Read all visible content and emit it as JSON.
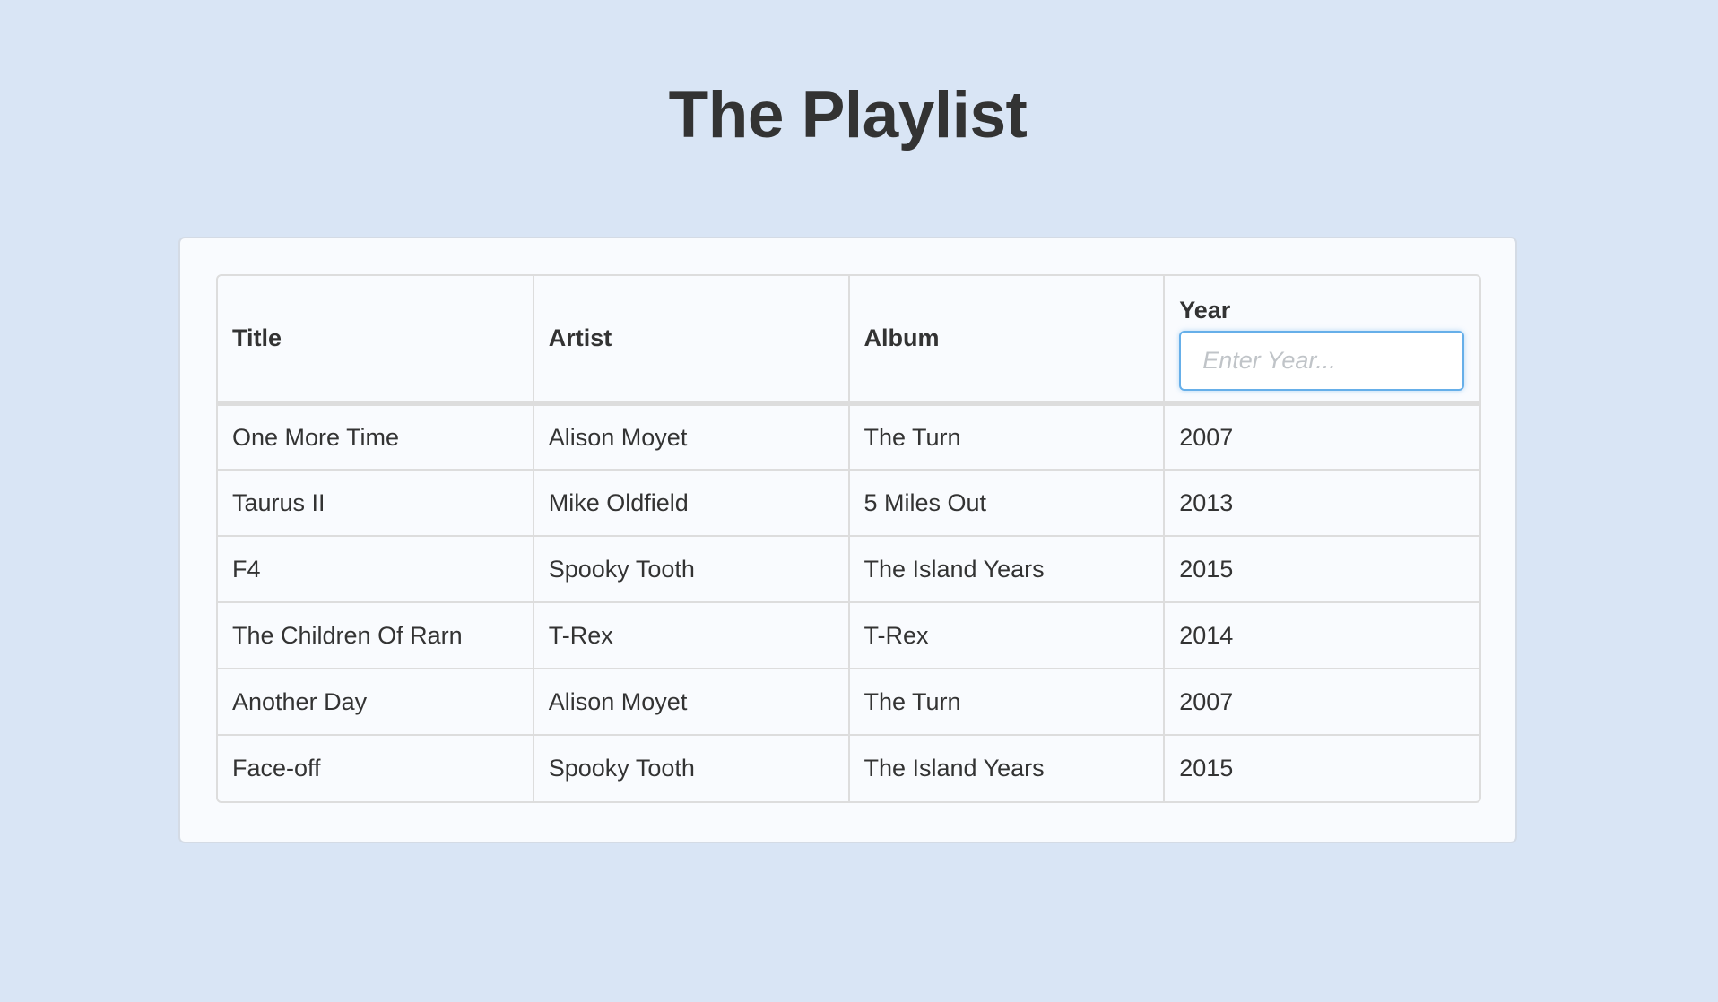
{
  "page": {
    "title": "The Playlist"
  },
  "table": {
    "columns": {
      "title": "Title",
      "artist": "Artist",
      "album": "Album",
      "year": "Year"
    },
    "year_filter": {
      "placeholder": "Enter Year...",
      "value": ""
    },
    "rows": [
      {
        "title": "One More Time",
        "artist": "Alison Moyet",
        "album": "The Turn",
        "year": "2007"
      },
      {
        "title": "Taurus II",
        "artist": "Mike Oldfield",
        "album": "5 Miles Out",
        "year": "2013"
      },
      {
        "title": "F4",
        "artist": "Spooky Tooth",
        "album": "The Island Years",
        "year": "2015"
      },
      {
        "title": "The Children Of Rarn",
        "artist": "T-Rex",
        "album": "T-Rex",
        "year": "2014"
      },
      {
        "title": "Another Day",
        "artist": "Alison Moyet",
        "album": "The Turn",
        "year": "2007"
      },
      {
        "title": "Face-off",
        "artist": "Spooky Tooth",
        "album": "The Island Years",
        "year": "2015"
      }
    ]
  },
  "colors": {
    "background": "#d9e5f5",
    "panel": "#f9fbfe",
    "text": "#333333",
    "input_focus_border": "#66afe9"
  }
}
